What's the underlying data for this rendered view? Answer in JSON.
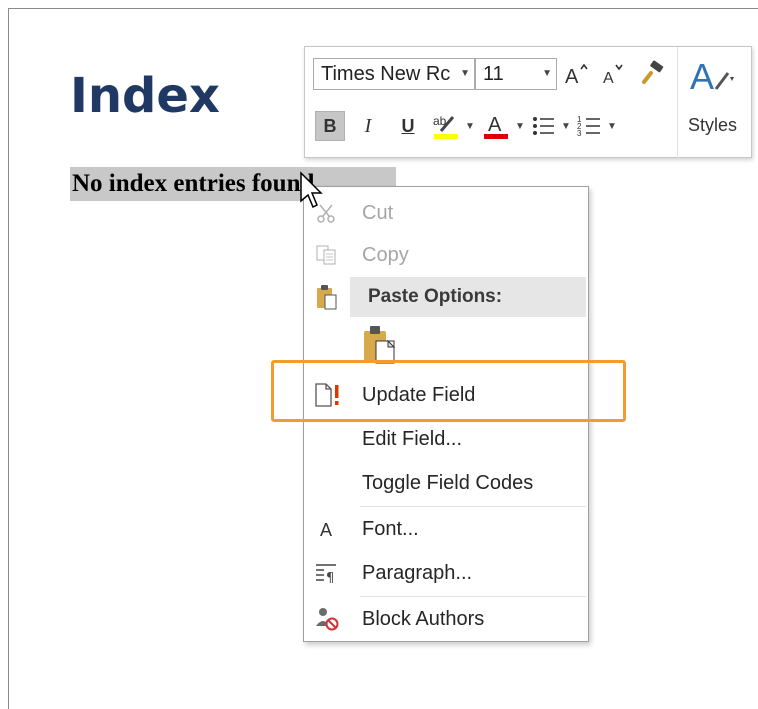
{
  "document": {
    "heading": "Index",
    "field_text": "No index entries found."
  },
  "mini_toolbar": {
    "font_name": "Times New Rc",
    "font_size": "11",
    "grow_font_icon": "grow-font-icon",
    "shrink_font_icon": "shrink-font-icon",
    "format_painter_icon": "format-painter-icon",
    "bold": "B",
    "italic": "I",
    "underline": "U",
    "highlight_color": "#ffff00",
    "font_color": "#e00000",
    "styles_label": "Styles",
    "bold_active": true
  },
  "context_menu": {
    "items": [
      {
        "label": "Cut",
        "icon": "scissors-icon",
        "enabled": false
      },
      {
        "label": "Copy",
        "icon": "copy-icon",
        "enabled": false
      },
      {
        "label": "Paste Options:",
        "icon": "clipboard-icon",
        "header": true
      },
      {
        "label": "",
        "icon": "paste-keep-formatting-icon"
      },
      {
        "label": "Update Field",
        "icon": "update-field-icon",
        "enabled": true
      },
      {
        "label": "Edit Field...",
        "icon": "",
        "enabled": true
      },
      {
        "label": "Toggle Field Codes",
        "icon": "",
        "enabled": true
      },
      {
        "label": "Font...",
        "icon": "font-icon",
        "enabled": true
      },
      {
        "label": "Paragraph...",
        "icon": "paragraph-icon",
        "enabled": true
      },
      {
        "label": "Block Authors",
        "icon": "block-authors-icon",
        "enabled": true
      }
    ]
  },
  "highlight_color": "#ef9d2e",
  "heading_color": "#1f3864"
}
